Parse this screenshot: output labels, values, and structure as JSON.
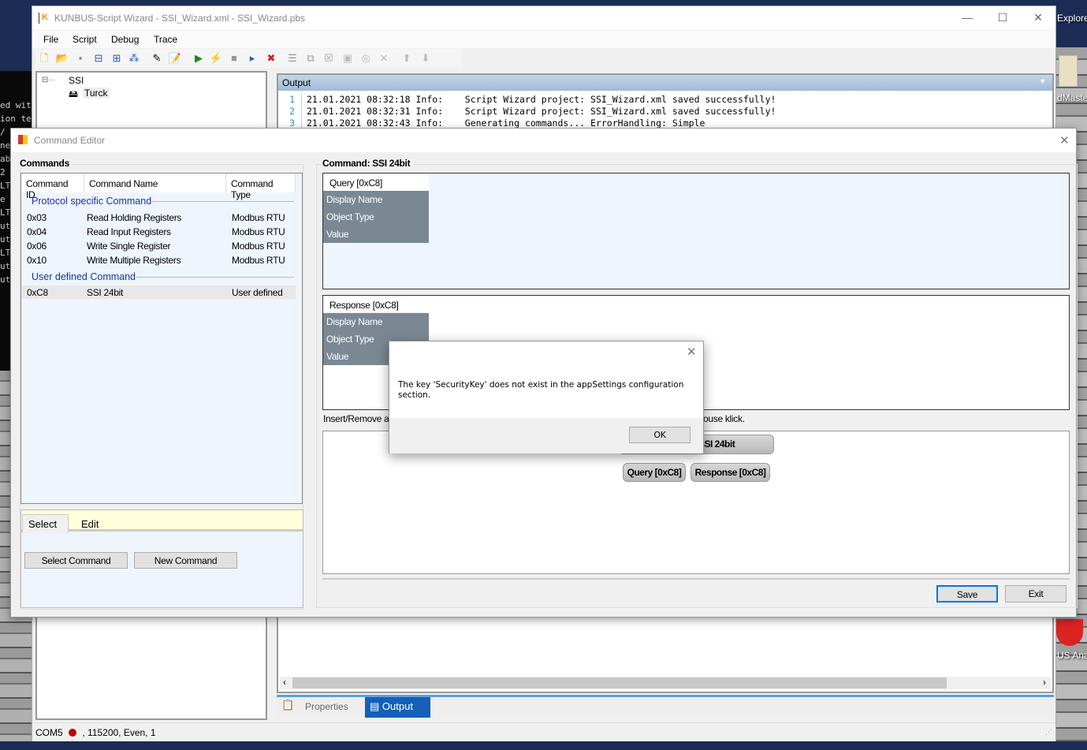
{
  "desktop": {
    "terminal_fragments": [
      "ed wit",
      "ion te",
      " /",
      "ne",
      "ab",
      " 2",
      "LT",
      "e",
      "LT",
      "ut",
      "ut",
      "",
      "LT",
      "ut",
      "ut"
    ],
    "icons": [
      "Explore",
      "dMaste",
      "US Analy"
    ]
  },
  "main_window": {
    "title": "KUNBUS-Script Wizard - SSI_Wizard.xml - SSI_Wizard.pbs",
    "menu": [
      "File",
      "Script",
      "Debug",
      "Trace"
    ],
    "toolbar_icons": [
      "new-file-icon",
      "open-folder-icon",
      "save-icon",
      "collapse-icon",
      "expand-icon",
      "tree-icon",
      "wizard-wand-icon",
      "edit-note-icon",
      "run-icon",
      "connect-plug-icon",
      "stop-icon",
      "step-icon",
      "step-clear-icon",
      "comment-icon",
      "copy-icon",
      "delete-icon",
      "play-disabled-icon",
      "record-disabled-icon",
      "close-disabled-icon",
      "up-arrow-icon",
      "down-arrow-icon"
    ],
    "tree": {
      "root": "SSI",
      "child": "Turck"
    },
    "output": {
      "title": "Output",
      "lines": [
        {
          "n": "1",
          "text": "21.01.2021 08:32:18 Info:    Script Wizard project: SSI_Wizard.xml saved successfully!"
        },
        {
          "n": "2",
          "text": "21.01.2021 08:32:31 Info:    Script Wizard project: SSI_Wizard.xml saved successfully!"
        },
        {
          "n": "3",
          "text": "21.01.2021 08:32:43 Info:    Generating commands... ErrorHandling: Simple"
        }
      ]
    },
    "bottom_tabs": [
      {
        "label": "Properties",
        "active": false
      },
      {
        "label": "Output",
        "active": true
      }
    ],
    "status": {
      "port": "COM5",
      "settings": ", 115200, Even, 1",
      "led_color": "#c00000"
    }
  },
  "command_editor": {
    "title": "Command Editor",
    "commands_group": "Commands",
    "columns": [
      "Command ID",
      "Command Name",
      "Command Type"
    ],
    "groups": [
      {
        "label": "Protocol specific Command",
        "rows": [
          {
            "id": "0x03",
            "name": "Read Holding Registers",
            "type": "Modbus RTU"
          },
          {
            "id": "0x04",
            "name": "Read Input Registers",
            "type": "Modbus RTU"
          },
          {
            "id": "0x06",
            "name": "Write Single Register",
            "type": "Modbus RTU"
          },
          {
            "id": "0x10",
            "name": "Write Multiple Registers",
            "type": "Modbus RTU"
          }
        ]
      },
      {
        "label": "User defined Command",
        "rows": [
          {
            "id": "0xC8",
            "name": "SSI 24bit",
            "type": "User defined"
          }
        ]
      }
    ],
    "tabs": [
      "Select",
      "Edit"
    ],
    "select_command": "Select Command",
    "new_command": "New Command",
    "command_group": "Command: SSI 24bit",
    "query": {
      "header": "Query [0xC8]",
      "fields": [
        "Display Name",
        "Object Type",
        "Value"
      ]
    },
    "response": {
      "header": "Response [0xC8]",
      "fields": [
        "Display Name",
        "Object Type",
        "Value"
      ]
    },
    "hint_left": "Insert/Remove a",
    "hint_right": "ouse klick.",
    "graph": {
      "root": "SSI 24bit",
      "children": [
        "Query [0xC8]",
        "Response [0xC8]"
      ]
    },
    "save": "Save",
    "exit": "Exit"
  },
  "message_box": {
    "text": "The key 'SecurityKey' does not exist in the appSettings configuration section.",
    "ok": "OK"
  }
}
